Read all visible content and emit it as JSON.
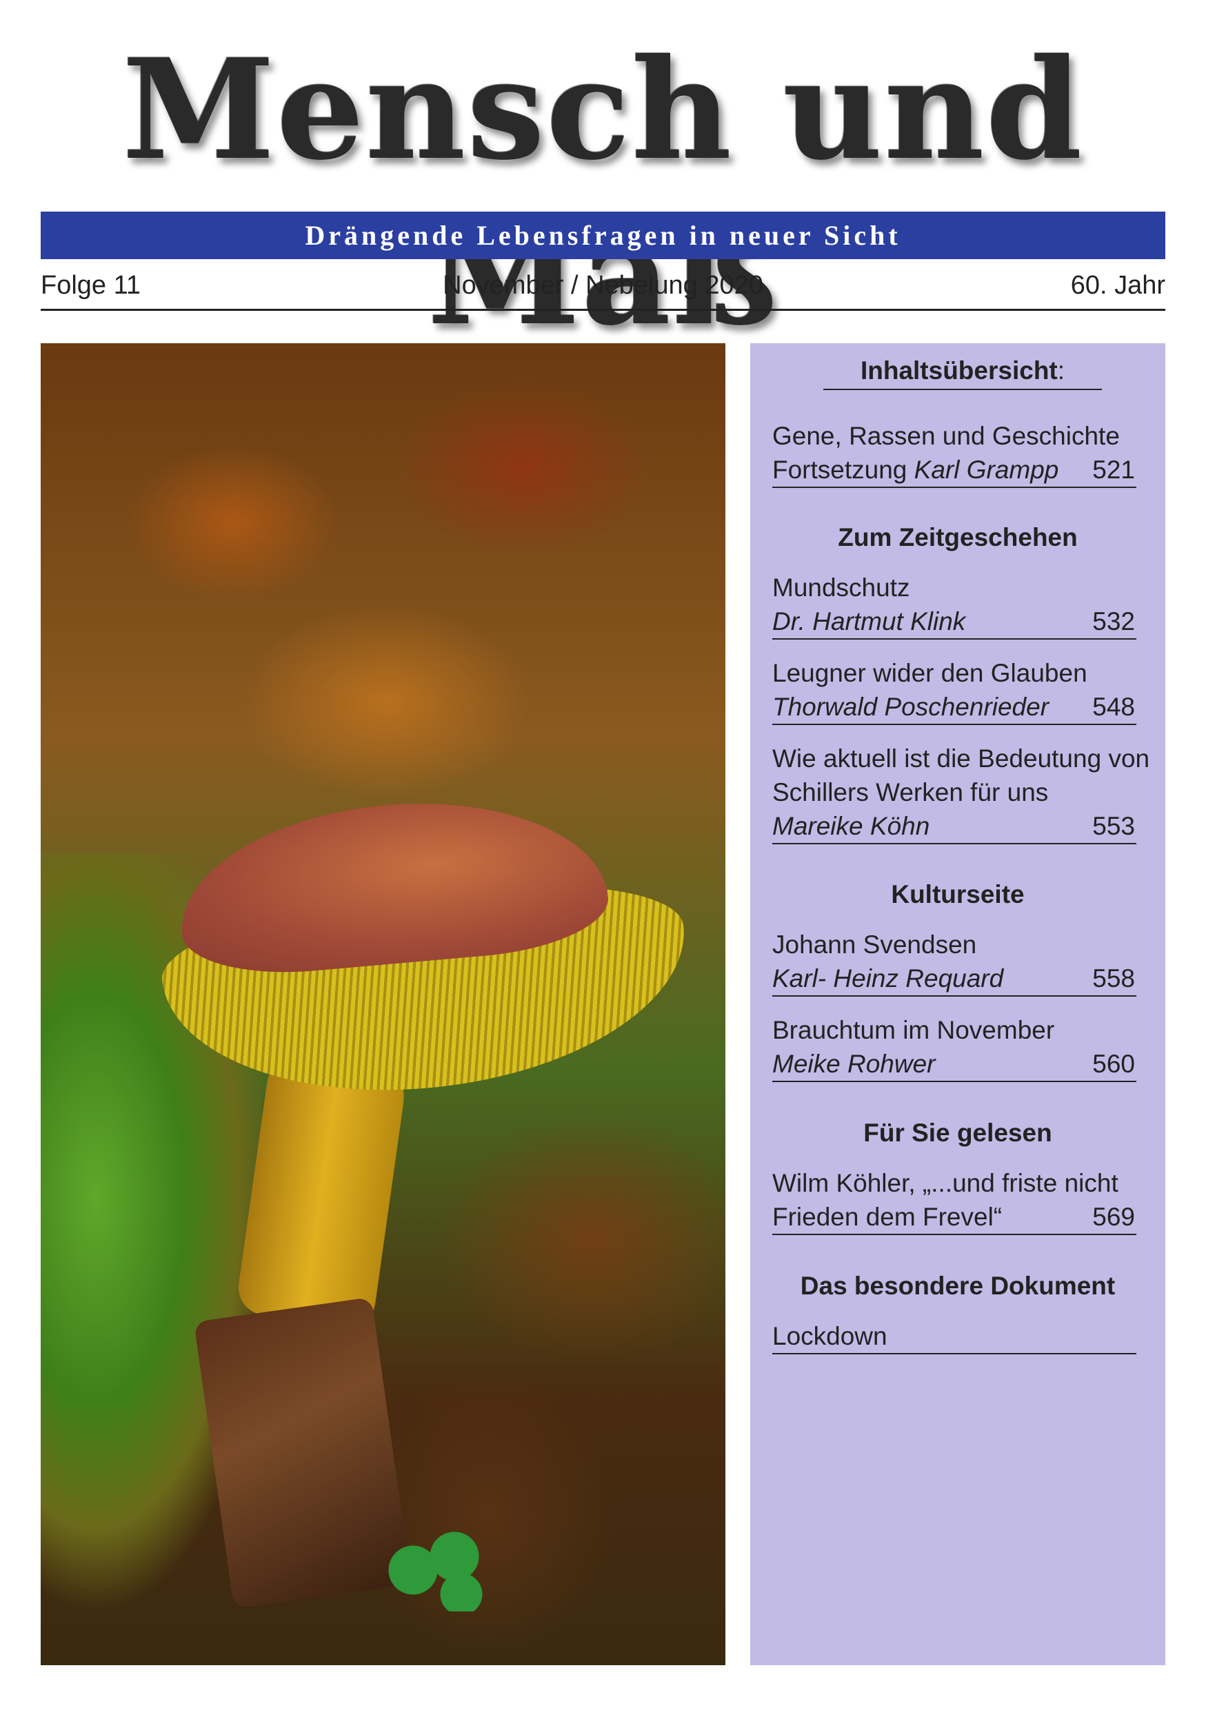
{
  "masthead": {
    "title": "Mensch und Maß"
  },
  "subtitle": "Drängende Lebensfragen in neuer Sicht",
  "issue": {
    "folge": "Folge 11",
    "month": "November / Nebelung 2020",
    "jahr": "60. Jahr"
  },
  "photo": {
    "description_icon": "mushroom-photo"
  },
  "toc": {
    "title_bold": "Inhaltsübersicht",
    "title_colon": ":",
    "entries_1": {
      "line1": "Gene, Rassen und Geschichte",
      "prefix": "Fortsetzung ",
      "author": "Karl Grampp",
      "page": "521"
    },
    "section_2": "Zum Zeitgeschehen",
    "entry_2a": {
      "title": "Mundschutz",
      "author": "Dr. Hartmut Klink",
      "page": "532"
    },
    "entry_2b": {
      "title": "Leugner wider den Glauben",
      "author": "Thorwald Poschenrieder",
      "page": "548"
    },
    "entry_2c": {
      "title1": "Wie aktuell ist die Bedeutung von",
      "title2": "Schillers Werken  für uns",
      "author": "Mareike Köhn",
      "page": "553"
    },
    "section_3": "Kulturseite",
    "entry_3a": {
      "title": "Johann Svendsen",
      "author": "Karl- Heinz Requard",
      "page": "558"
    },
    "entry_3b": {
      "title": "Brauchtum im November",
      "author": "Meike Rohwer",
      "page": "560"
    },
    "section_4": "Für Sie gelesen",
    "entry_4a": {
      "title1": "Wilm Köhler, „...und friste nicht",
      "title2": "Frieden dem Frevel“",
      "page": "569"
    },
    "section_5": "Das besondere Dokument",
    "entry_5a": {
      "title": "Lockdown"
    }
  }
}
